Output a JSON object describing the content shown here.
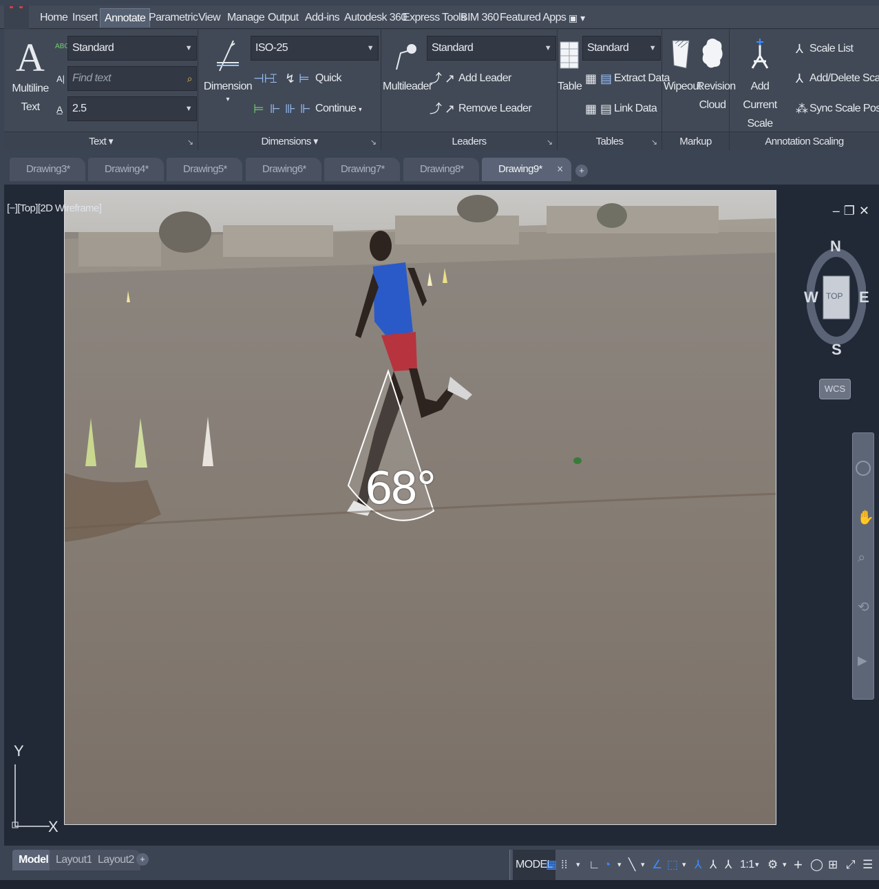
{
  "menubar": {
    "tabs": [
      "Home",
      "Insert",
      "Annotate",
      "Parametric",
      "View",
      "Manage",
      "Output",
      "Add-ins",
      "Autodesk 360",
      "Express Tools",
      "BIM 360",
      "Featured Apps"
    ],
    "active_tab": "Annotate"
  },
  "ribbon": {
    "text_panel": {
      "title": "Text ▾",
      "multiline_label_1": "Multiline",
      "multiline_label_2": "Text",
      "style_combo": "Standard",
      "find_placeholder": "Find text",
      "height_combo": "2.5"
    },
    "dimensions_panel": {
      "title": "Dimensions ▾",
      "dimension_label": "Dimension",
      "dimstyle_combo": "ISO-25",
      "quick_label": "Quick",
      "continue_label": "Continue"
    },
    "leaders_panel": {
      "title": "Leaders",
      "multileader_label": "Multileader",
      "style_combo": "Standard",
      "add_leader_label": "Add Leader",
      "remove_leader_label": "Remove Leader"
    },
    "tables_panel": {
      "title": "Tables",
      "table_label": "Table",
      "style_combo": "Standard",
      "extract_data_label": "Extract Data",
      "link_data_label": "Link Data"
    },
    "markup_panel": {
      "title": "Markup",
      "wipeout_label": "Wipeout",
      "revision_label_1": "Revision",
      "revision_label_2": "Cloud"
    },
    "annotation_scaling_panel": {
      "title": "Annotation Scaling",
      "add_label_1": "Add",
      "add_label_2": "Current Scale",
      "scale_list_label": "Scale List",
      "add_delete_scales_label": "Add/Delete Scales",
      "sync_scale_label": "Sync Scale Positions"
    }
  },
  "file_tabs": {
    "tabs": [
      "Drawing3*",
      "Drawing4*",
      "Drawing5*",
      "Drawing6*",
      "Drawing7*",
      "Drawing8*",
      "Drawing9*"
    ],
    "active": "Drawing9*"
  },
  "viewport": {
    "label": "[−][Top][2D Wireframe]",
    "angle_annotation": "68°",
    "compass": {
      "n": "N",
      "s": "S",
      "e": "E",
      "w": "W",
      "face": "TOP"
    },
    "wcs_label": "WCS",
    "ucs_x": "X",
    "ucs_y": "Y"
  },
  "layout_tabs": {
    "tabs": [
      "Model",
      "Layout1",
      "Layout2"
    ],
    "active": "Model"
  },
  "statusbar": {
    "model_label": "MODEL",
    "scale_label": "1:1"
  },
  "colors": {
    "ribbon_bg": "#414956",
    "viewport_bg": "#222936",
    "accent_blue": "#3d8cff"
  }
}
